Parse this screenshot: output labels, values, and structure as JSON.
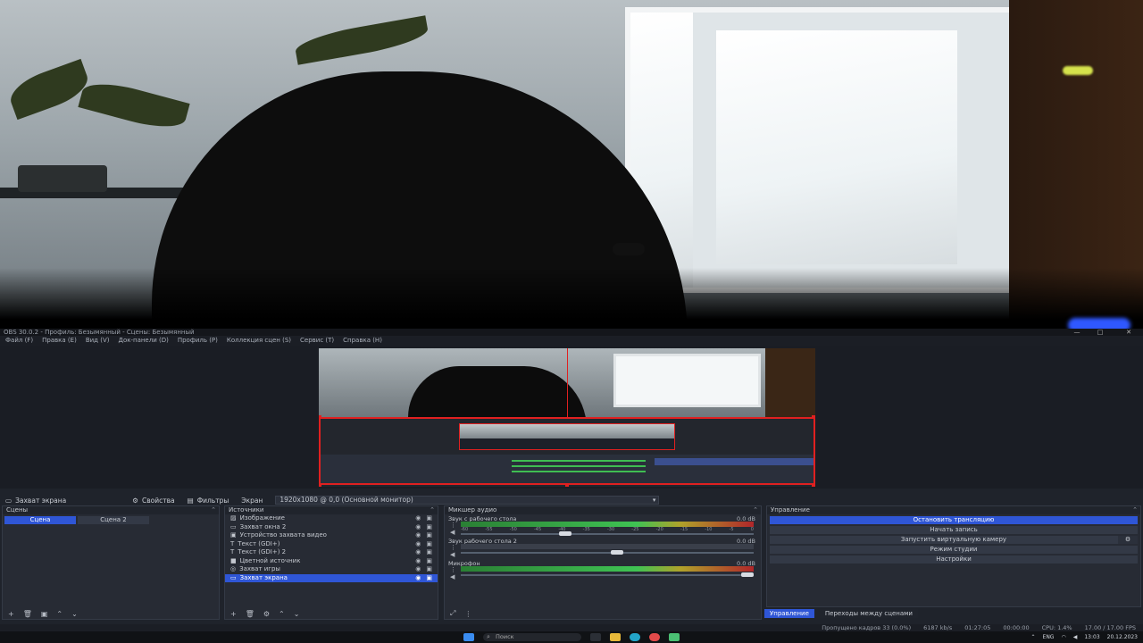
{
  "obs": {
    "title": "OBS 30.0.2 - Профиль: Безымянный - Сцены: Безымянный",
    "menu": [
      "Файл (F)",
      "Правка (E)",
      "Вид (V)",
      "Док-панели (D)",
      "Профиль (P)",
      "Коллекция сцен (S)",
      "Сервис (T)",
      "Справка (H)"
    ],
    "window_controls": [
      "—",
      "□",
      "✕"
    ]
  },
  "sourcebar": {
    "active_source": "Захват экрана",
    "properties": "Свойства",
    "filters": "Фильтры",
    "screen_label": "Экран",
    "screen_value": "1920x1080 @ 0,0 (Основной монитор)"
  },
  "scenes": {
    "title": "Сцены",
    "items": [
      {
        "label": "Сцена",
        "active": true
      },
      {
        "label": "Сцена 2",
        "active": false
      }
    ]
  },
  "sources": {
    "title": "Источники",
    "items": [
      {
        "label": "Изображение",
        "selected": false
      },
      {
        "label": "Захват окна 2",
        "selected": false
      },
      {
        "label": "Устройство захвата видео",
        "selected": false
      },
      {
        "label": "Текст (GDI+)",
        "selected": false
      },
      {
        "label": "Текст (GDI+) 2",
        "selected": false
      },
      {
        "label": "Цветной источник",
        "selected": false
      },
      {
        "label": "Захват игры",
        "selected": false
      },
      {
        "label": "Захват экрана",
        "selected": true
      }
    ]
  },
  "mixer": {
    "title": "Микшер аудио",
    "channels": [
      {
        "name": "Звук с рабочего стола",
        "db": "0.0 dB"
      },
      {
        "name": "Звук рабочего стола 2",
        "db": "0.0 dB"
      },
      {
        "name": "Микрофон",
        "db": "0.0 dB"
      }
    ],
    "scale": [
      "-60",
      "-55",
      "-50",
      "-45",
      "-40",
      "-35",
      "-30",
      "-25",
      "-20",
      "-15",
      "-10",
      "-5",
      "0"
    ]
  },
  "controls": {
    "title": "Управление",
    "buttons": {
      "stop_stream": "Остановить трансляцию",
      "start_record": "Начать запись",
      "virtual_cam": "Запустить виртуальную камеру",
      "studio_mode": "Режим студии",
      "settings": "Настройки"
    },
    "tabs": [
      "Управление",
      "Переходы между сценами"
    ]
  },
  "status": {
    "dropped": "Пропущено кадров 33 (0.0%)",
    "bitrate": "6187 kb/s",
    "live_time": "01:27:05",
    "rec_time": "00:00:00",
    "cpu": "CPU: 1.4%",
    "fps": "17.00 / 17.00 FPS"
  },
  "taskbar": {
    "search": "Поиск",
    "time": "13:03",
    "date": "20.12.2023",
    "lang": "ENG"
  },
  "colors": {
    "accent": "#2f56d6",
    "selection": "#e02020",
    "panel": "#272b34"
  }
}
